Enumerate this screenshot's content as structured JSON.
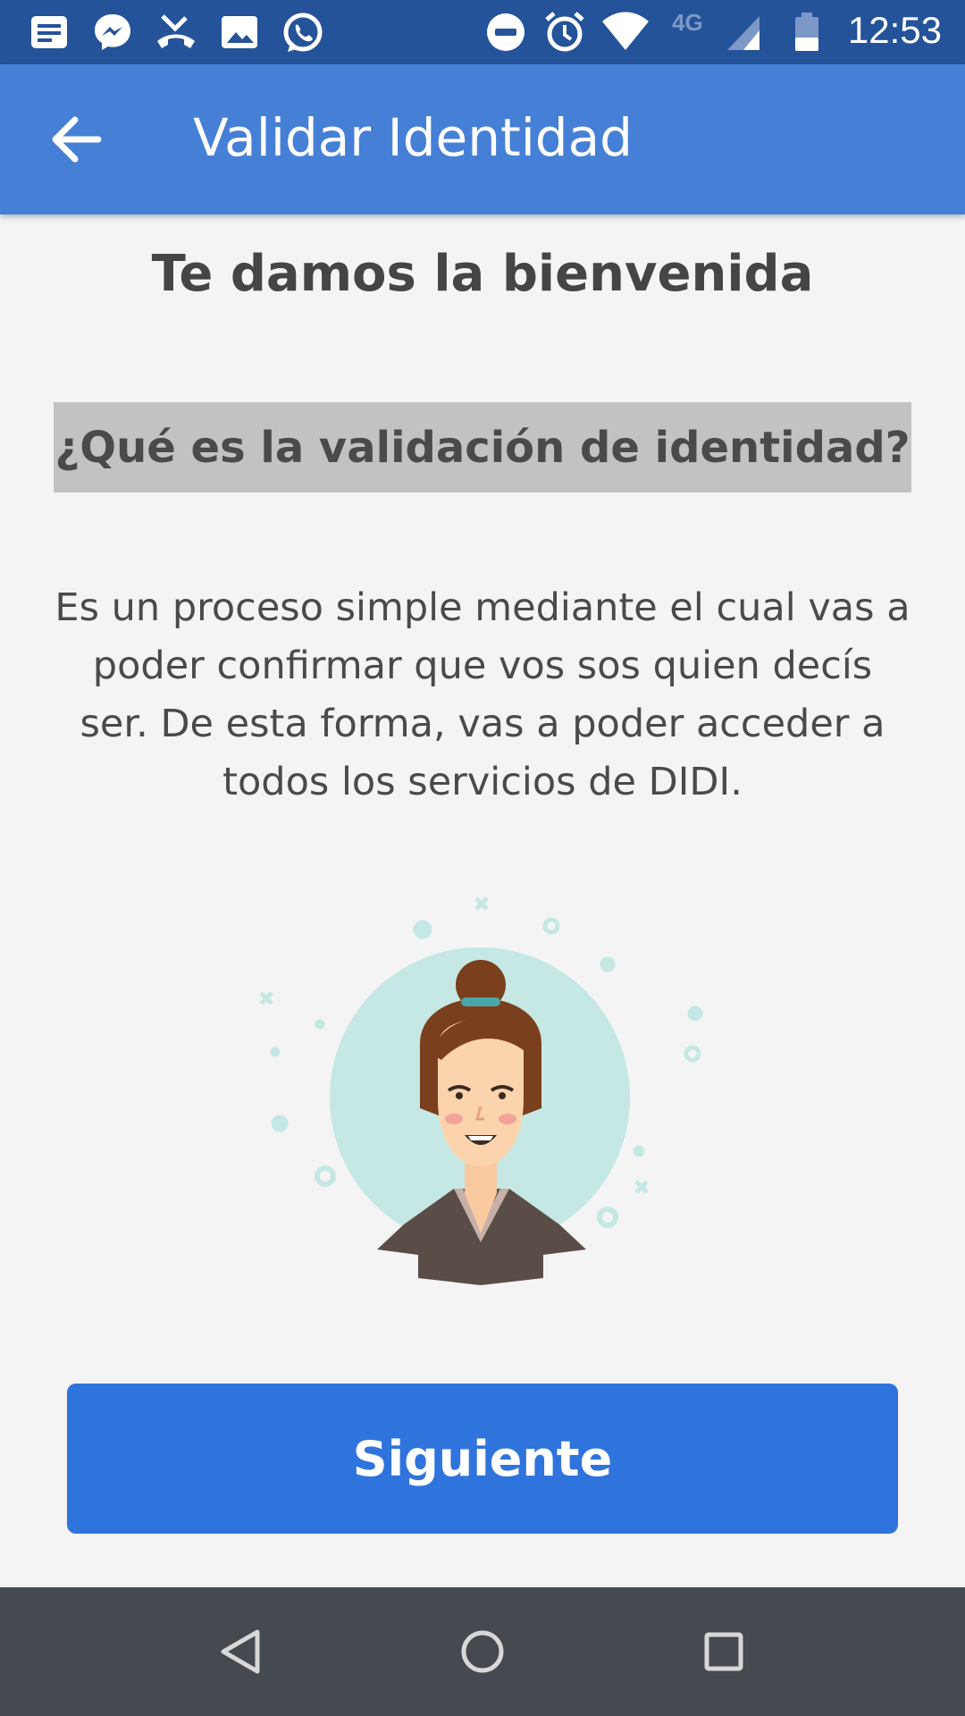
{
  "status_bar": {
    "time": "12:53",
    "network_label": "4G",
    "icons": [
      "notes-icon",
      "messenger-icon",
      "missed-call-icon",
      "image-icon",
      "whatsapp-icon",
      "dnd-icon",
      "alarm-icon",
      "wifi-icon",
      "signal-icon",
      "battery-icon"
    ]
  },
  "app_bar": {
    "title": "Validar Identidad",
    "back_icon": "arrow-left-icon"
  },
  "content": {
    "heading": "Te damos la bienvenida",
    "question": "¿Qué es la validación de identidad?",
    "description": "Es un proceso simple mediante el cual vas a poder confirmar que vos sos quien decís ser. De esta forma, vas a poder acceder a todos los servicios de DIDI."
  },
  "actions": {
    "next_label": "Siguiente"
  },
  "nav_bar": {
    "icons": [
      "back-triangle-icon",
      "home-circle-icon",
      "recents-square-icon"
    ]
  },
  "colors": {
    "status_bar": "#24539a",
    "app_bar": "#4580d6",
    "button": "#2f74dc",
    "nav_bar": "#454a50",
    "illustration_circle": "#c5e8e4"
  }
}
